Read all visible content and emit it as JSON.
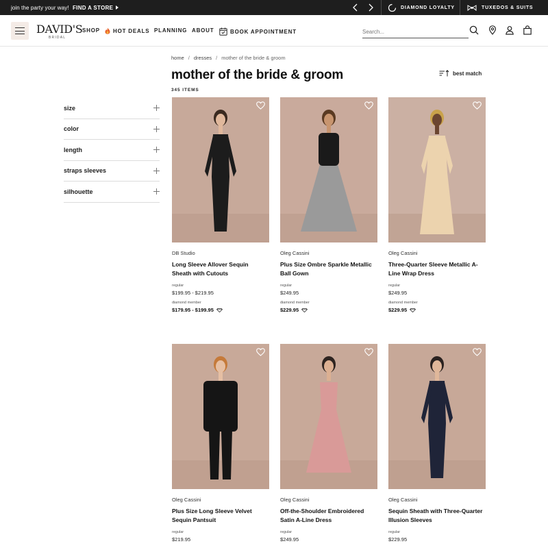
{
  "topbar": {
    "promo": "join the party your way!",
    "find_store": "FIND A STORE",
    "loyalty": "DIAMOND LOYALTY",
    "tuxedos": "TUXEDOS & SUITS"
  },
  "header": {
    "logo": "DAVID'S",
    "logo_sub": "BRIDAL",
    "nav": [
      {
        "label": "SHOP"
      },
      {
        "label": "HOT DEALS",
        "icon": "flame-icon"
      },
      {
        "label": "PLANNING"
      },
      {
        "label": "ABOUT"
      },
      {
        "label": "BOOK APPOINTMENT",
        "icon": "calendar-icon"
      }
    ],
    "search_placeholder": "Search..."
  },
  "breadcrumb": [
    "home",
    "dresses",
    "mother of the bride & groom"
  ],
  "page": {
    "title": "mother of the bride & groom",
    "count": "345 ITEMS",
    "sort": "best match"
  },
  "filters": [
    "size",
    "color",
    "length",
    "straps sleeves",
    "silhouette"
  ],
  "products": [
    {
      "brand": "DB Studio",
      "name": "Long Sleeve Allover Sequin Sheath with Cutouts",
      "regular_label": "regular",
      "regular_price": "$199.95 - $219.95",
      "member_label": "diamond member",
      "member_price": "$179.95 - $199.95",
      "bg": "#c7a99a",
      "dress": "#1c1c1c",
      "skin": "#e0b89c",
      "hair": "#3a2a20"
    },
    {
      "brand": "Oleg Cassini",
      "name": "Plus Size Ombre Sparkle Metallic Ball Gown",
      "regular_label": "regular",
      "regular_price": "$249.95",
      "member_label": "diamond member",
      "member_price": "$229.95",
      "bg": "#c9aa9c",
      "dress": "#9a9a9a",
      "skin": "#c8956f",
      "hair": "#5a3a22"
    },
    {
      "brand": "Oleg Cassini",
      "name": "Three-Quarter Sleeve Metallic A-Line Wrap Dress",
      "regular_label": "regular",
      "regular_price": "$249.95",
      "member_label": "diamond member",
      "member_price": "$229.95",
      "bg": "#cbb0a3",
      "dress": "#ecd3ae",
      "skin": "#6b4530",
      "hair": "#c9a24a"
    },
    {
      "brand": "Oleg Cassini",
      "name": "Plus Size Long Sleeve Velvet Sequin Pantsuit",
      "regular_label": "regular",
      "regular_price": "$219.95",
      "member_label": "",
      "member_price": "",
      "bg": "#c8a999",
      "dress": "#151515",
      "skin": "#e6bfa3",
      "hair": "#c57a3a"
    },
    {
      "brand": "Oleg Cassini",
      "name": "Off-the-Shoulder Embroidered Satin A-Line Dress",
      "regular_label": "regular",
      "regular_price": "$249.95",
      "member_label": "",
      "member_price": "",
      "bg": "#c8a999",
      "dress": "#d99a98",
      "skin": "#dcb092",
      "hair": "#2e2420"
    },
    {
      "brand": "Oleg Cassini",
      "name": "Sequin Sheath with Three-Quarter Illusion Sleeves",
      "regular_label": "regular",
      "regular_price": "$229.95",
      "member_label": "",
      "member_price": "",
      "bg": "#c7a898",
      "dress": "#1f2438",
      "skin": "#e0b79a",
      "hair": "#2a2220"
    }
  ]
}
